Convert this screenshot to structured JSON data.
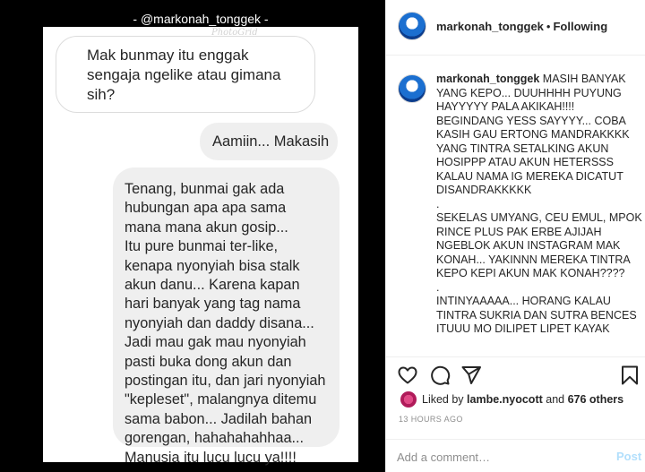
{
  "media": {
    "handle_caption": "- @markonah_tonggek -",
    "watermark": "PhotoGrid",
    "bubble1": [
      "Mak bunmay itu enggak",
      "sengaja ngelike atau gimana",
      "sih?"
    ],
    "bubble2": "Aamiin... Makasih",
    "bubble3": [
      "Tenang, bunmai gak ada",
      "hubungan apa apa sama",
      "mana mana akun gosip...",
      "Itu pure bunmai ter-like,",
      "kenapa nyonyiah bisa stalk",
      "akun danu... Karena kapan",
      "hari banyak yang tag nama",
      "nyonyiah dan daddy disana...",
      "Jadi mau gak mau nyonyiah",
      "pasti buka dong akun dan",
      "postingan itu, dan jari nyonyiah",
      "\"kepleset\", malangnya ditemu",
      "sama babon... Jadilah bahan",
      "gorengan, hahahahahhaa...",
      "Manusia itu lucu lucu ya!!!!"
    ]
  },
  "header": {
    "username": "markonah_tonggek",
    "separator": "•",
    "follow_status": "Following"
  },
  "caption": {
    "username": "markonah_tonggek",
    "first_line_rest": " MASIH BANYAK",
    "lines": [
      "YANG KEPO... DUUHHHH PUYUNG",
      "HAYYYYY PALA AKIKAH!!!!",
      "BEGINDANG YESS SAYYYY... COBA",
      "KASIH GAU ERTONG MANDRAKKKK",
      "YANG TINTRA SETALKING AKUN",
      "HOSIPPP ATAU AKUN HETERSSS",
      "KALAU NAMA IG MEREKA DICATUT",
      "DISANDRAKKKKK",
      ".",
      "SEKELAS UMYANG, CEU EMUL, MPOK",
      "RINCE PLUS PAK ERBE AJIJAH",
      "NGEBLOK AKUN INSTAGRAM MAK",
      "KONAH... YAKINNN MEREKA TINTRA",
      "KEPO KEPI AKUN MAK KONAH????",
      ".",
      "INTINYAAAAA... HORANG KALAU",
      "TINTRA SUKRIA DAN SUTRA BENCES",
      "ITUUU MO DILIPET LIPET KAYAK"
    ]
  },
  "actions": {
    "icons": [
      "heart-icon",
      "comment-icon",
      "share-icon",
      "bookmark-icon"
    ]
  },
  "likes": {
    "prefix": "Liked by ",
    "liked_by_user": "lambe.nyocott",
    "middle": " and ",
    "others": "676 others"
  },
  "timestamp": "13 HOURS AGO",
  "comment_box": {
    "placeholder": "Add a comment…",
    "post_label": "Post"
  },
  "colors": {
    "link_disabled": "#b2dffc",
    "text": "#262626",
    "muted": "#8e8e8e"
  }
}
